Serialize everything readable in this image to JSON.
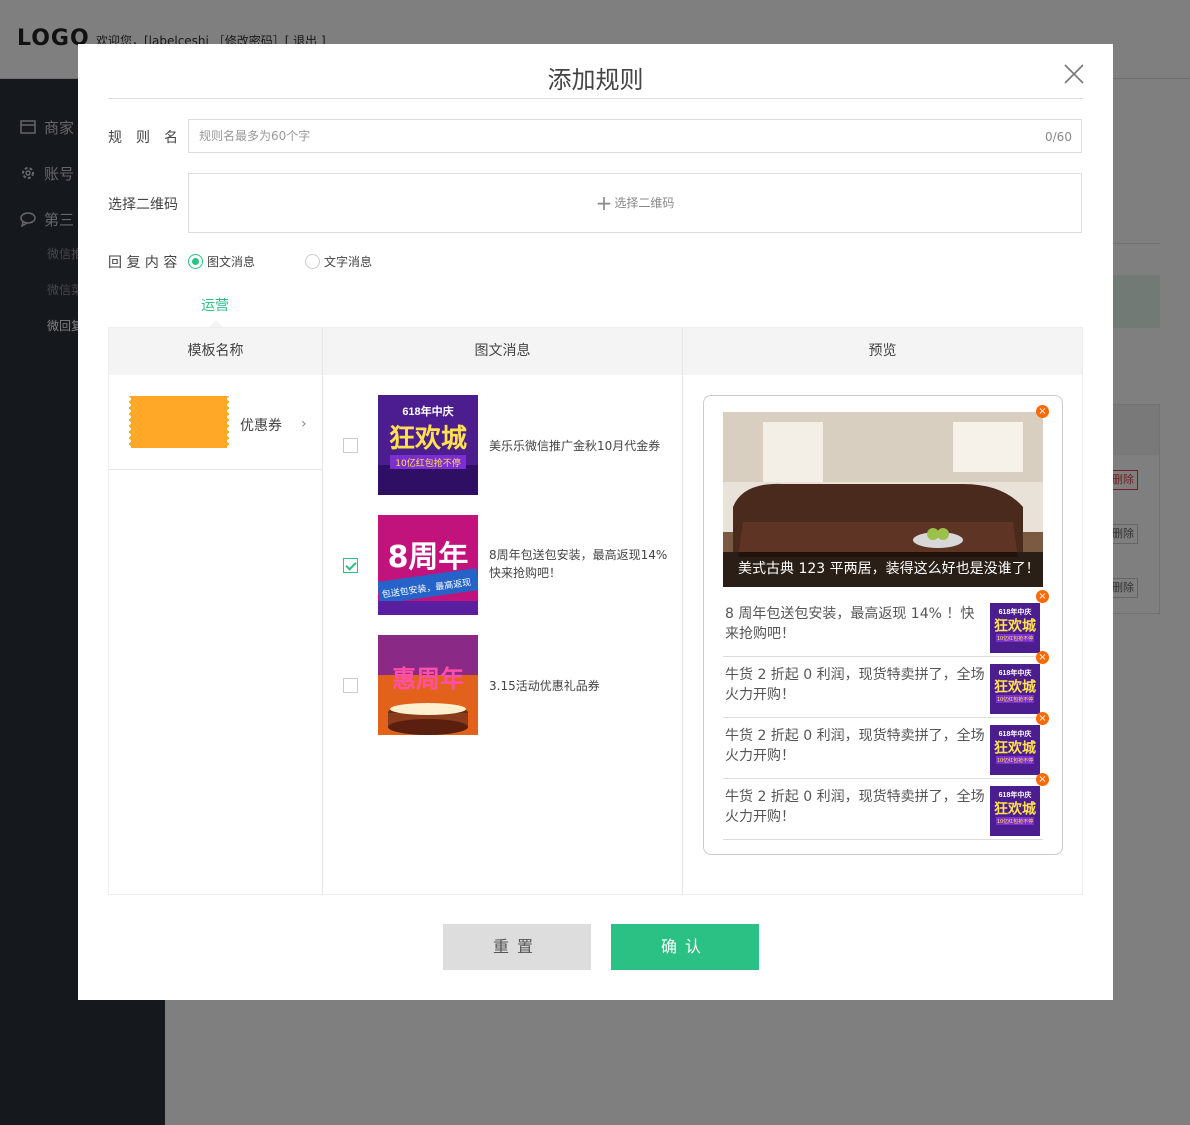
{
  "app": {
    "logo": "LOGO",
    "welcome": "欢迎您，[labelceshi ［修改密码］[ 退出 ]"
  },
  "sidebar": {
    "items": [
      {
        "label": "商家",
        "icon": "store-icon"
      },
      {
        "label": "账号",
        "icon": "gear-icon"
      },
      {
        "label": "第三",
        "icon": "chat-bubble-icon"
      }
    ],
    "subitems": [
      {
        "label": "微信推"
      },
      {
        "label": "微信菜"
      },
      {
        "label": "微回复"
      }
    ]
  },
  "background": {
    "delete_labels": [
      "删除",
      "删除",
      "删除"
    ]
  },
  "modal": {
    "title": "添加规则",
    "rule_name": {
      "label": "规　则　名",
      "placeholder": "规则名最多为60个字",
      "value": "",
      "counter": "0/60"
    },
    "qrcode": {
      "label": "选择二维码",
      "button_label": "选择二维码"
    },
    "reply": {
      "label": "回 复 内 容",
      "options": [
        {
          "label": "图文消息",
          "selected": true
        },
        {
          "label": "文字消息",
          "selected": false
        }
      ]
    },
    "tab": "运营",
    "table": {
      "headers": [
        "模板名称",
        "图文消息",
        "预览"
      ],
      "templates": [
        {
          "label": "优惠券"
        }
      ],
      "messages": [
        {
          "text": "美乐乐微信推广金秋10月代金券",
          "checked": false,
          "thumb": "618"
        },
        {
          "text": "8周年包送包安装，最高返现14%快来抢购吧！",
          "checked": true,
          "thumb": "8anniv"
        },
        {
          "text": "3.15活动优惠礼品券",
          "checked": false,
          "thumb": "cake"
        }
      ]
    },
    "preview": {
      "cover_caption": "美式古典 123 平两居，装得这么好也是没谁了！",
      "items": [
        {
          "text": "8 周年包送包安装，最高返现 14% ！快来抢购吧！"
        },
        {
          "text": "牛货 2 折起 0 利润，现货特卖拼了，全场火力开购！"
        },
        {
          "text": "牛货 2 折起 0 利润，现货特卖拼了，全场火力开购！"
        },
        {
          "text": "牛货 2 折起 0 利润，现货特卖拼了，全场火力开购！"
        }
      ]
    },
    "buttons": {
      "reset": "重置",
      "confirm": "确认"
    }
  },
  "thumb_texts": {
    "t618_top": "618年中庆",
    "t618_main": "狂欢城",
    "t618_sub": "10亿红包抢不停",
    "anniv_main": "8周年",
    "anniv_sub": "包送包安装，最高返现",
    "cake_main": "惠周年"
  },
  "colors": {
    "accent": "#2cc184",
    "coupon": "#ffa726",
    "remove": "#ff6a00"
  }
}
